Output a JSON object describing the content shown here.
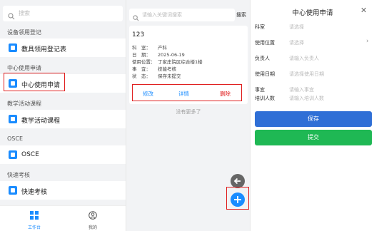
{
  "left": {
    "search_placeholder": "搜索",
    "sections": [
      {
        "title": "设备领用登记",
        "item": "教具领用登记表"
      },
      {
        "title": "中心使用申请",
        "item": "中心使用申请"
      },
      {
        "title": "教学活动课程",
        "item": "教学活动课程"
      },
      {
        "title": "OSCE",
        "item": "OSCE"
      },
      {
        "title": "快速考核",
        "item": "快速考核"
      }
    ],
    "tabs": [
      {
        "label": "工作台"
      },
      {
        "label": "我的"
      }
    ]
  },
  "middle": {
    "search_placeholder": "请输入关键词搜索",
    "search_button": "搜索",
    "record": {
      "id": "123",
      "rows": [
        {
          "k": "科　室：",
          "v": "产科"
        },
        {
          "k": "日　期：",
          "v": "2025-06-19"
        },
        {
          "k": "使用位置：",
          "v": "丁家庄院区综合楼1楼"
        },
        {
          "k": "事　宜：",
          "v": "技能考核"
        },
        {
          "k": "状　态：",
          "v": "保存未提交"
        }
      ],
      "actions": {
        "edit": "修改",
        "detail": "详情",
        "delete": "删除"
      }
    },
    "no_more": "没有更多了"
  },
  "right": {
    "title": "中心使用申请",
    "fields": [
      {
        "label": "科室",
        "placeholder": "请选择",
        "chevron": false
      },
      {
        "label": "使用位置",
        "placeholder": "请选择",
        "chevron": true
      },
      {
        "label": "负责人",
        "placeholder": "请输入负责人",
        "chevron": false
      },
      {
        "label": "使用日期",
        "placeholder": "请选择使用日期",
        "chevron": false
      },
      {
        "label": "事宜",
        "placeholder": "请输入事宜",
        "chevron": false
      },
      {
        "label": "培训人数",
        "placeholder": "请输入培训人数",
        "chevron": false
      }
    ],
    "save": "保存",
    "submit": "提交"
  },
  "colors": {
    "accent": "#1a8cff",
    "highlight": "#e02020",
    "save": "#2f6fd6",
    "submit": "#1fb854"
  },
  "icons": [
    "search-icon",
    "app-icon",
    "grid-icon",
    "user-icon",
    "back-arrow-icon",
    "plus-icon",
    "close-icon",
    "chevron-right-icon"
  ]
}
